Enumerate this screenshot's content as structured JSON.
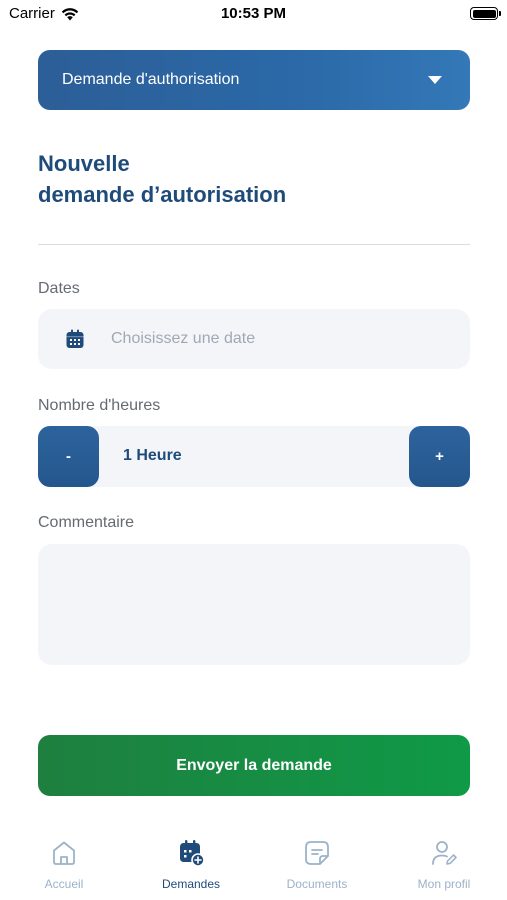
{
  "status_bar": {
    "carrier": "Carrier",
    "time": "10:53 PM"
  },
  "request_type": {
    "selected": "Demande d'authorisation"
  },
  "page_title": {
    "line1": "Nouvelle",
    "line2": "demande d’autorisation"
  },
  "form": {
    "dates_label": "Dates",
    "date_placeholder": "Choisissez une date",
    "hours_label": "Nombre d'heures",
    "decrement_label": "-",
    "increment_label": "+",
    "hours_value": "1 Heure",
    "comment_label": "Commentaire",
    "comment_value": ""
  },
  "submit_label": "Envoyer la demande",
  "tabs": [
    {
      "label": "Accueil",
      "icon": "home-icon",
      "active": false
    },
    {
      "label": "Demandes",
      "icon": "calendar-add-icon",
      "active": true
    },
    {
      "label": "Documents",
      "icon": "document-icon",
      "active": false
    },
    {
      "label": "Mon profil",
      "icon": "user-edit-icon",
      "active": false
    }
  ],
  "colors": {
    "primary": "#2b69a8",
    "title": "#1f4b7b",
    "success": "#0f9a47",
    "field_bg": "#f3f5f9",
    "tab_inactive": "#9cb2c9"
  }
}
